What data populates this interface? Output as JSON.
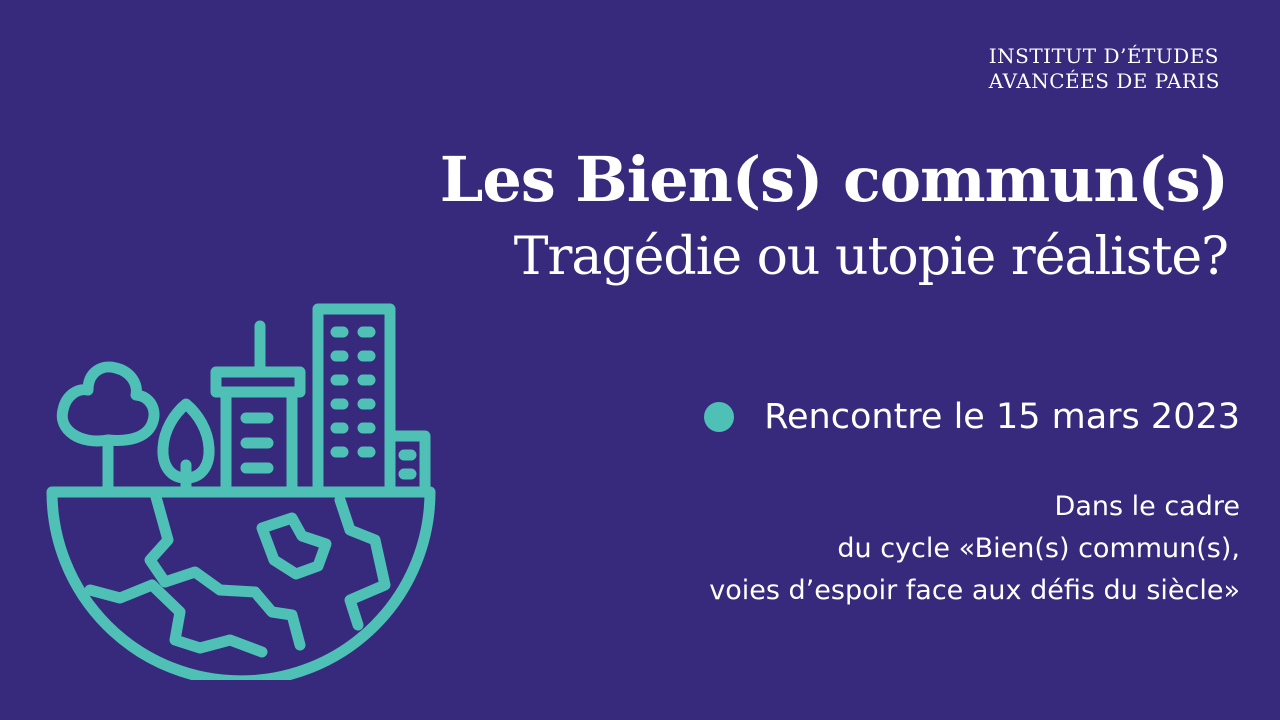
{
  "header": {
    "institute_line1": "INSTITUT D’ÉTUDES",
    "institute_line2": "AVANCÉES DE PARIS"
  },
  "title": "Les Bien(s) commun(s)",
  "subtitle": "Tragédie ou utopie réaliste?",
  "event": {
    "label": "Rencontre le 15 mars 2023"
  },
  "context": {
    "line1": "Dans le cadre",
    "line2": "du cycle «Bien(s) commun(s),",
    "line3": "voies d’espoir face aux défis du siècle»"
  },
  "colors": {
    "background": "#372a7c",
    "accent": "#4fc0b5",
    "text": "#ffffff"
  },
  "illustration": {
    "icon": "city-earth-icon"
  }
}
